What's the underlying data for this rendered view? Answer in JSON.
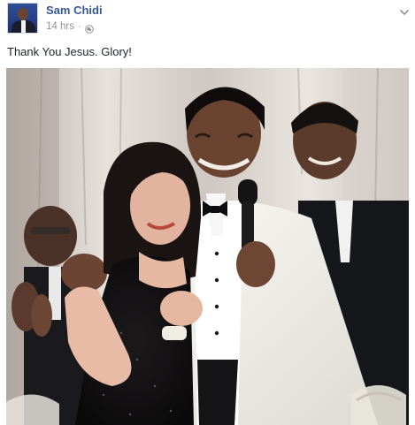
{
  "post": {
    "author": {
      "name": "Sam Chidi"
    },
    "timestamp": "14 hrs",
    "separator": "·",
    "privacy_icon": "globe-icon",
    "menu_icon": "chevron-down-icon",
    "text": "Thank You Jesus. Glory!"
  },
  "photo": {
    "subject": "Man in a white tuxedo jacket with a black bow tie holding a microphone, hugging a woman in a black sparkly dress; a smiling man in a dark suit and other guests behind them"
  },
  "colors": {
    "link": "#365899",
    "text": "#1d2129",
    "meta": "#90949c",
    "avatar_bg": "#2f4f96"
  }
}
